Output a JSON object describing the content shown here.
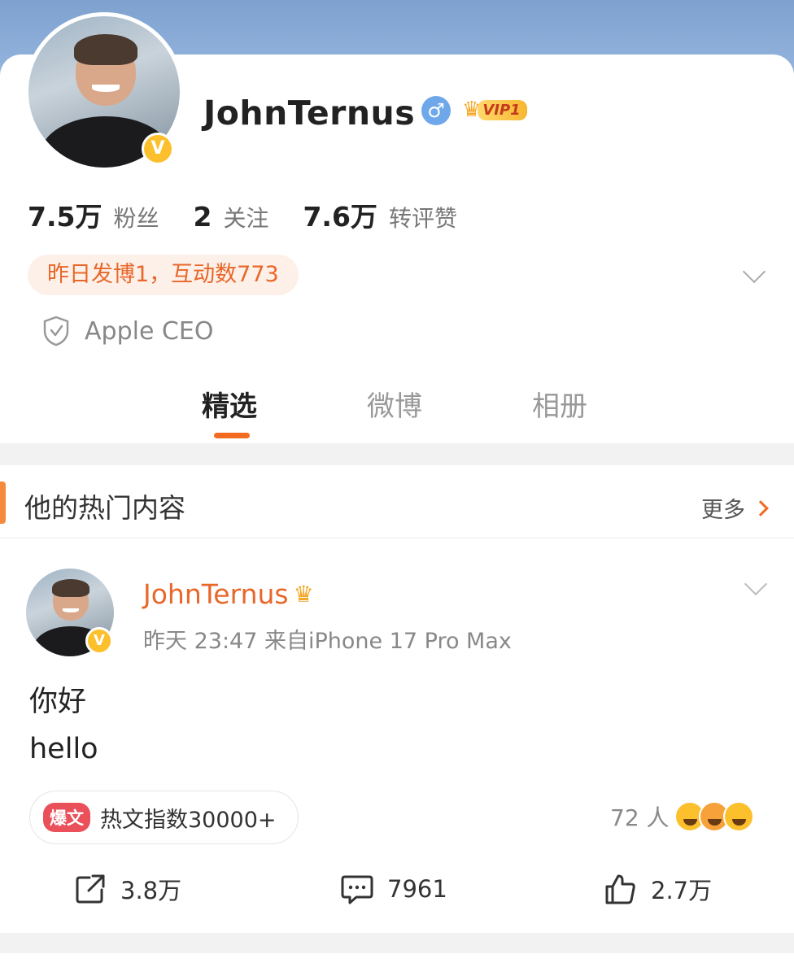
{
  "profile": {
    "username": "JohnTernus",
    "vip_label": "VIP1",
    "verified_mark": "V",
    "gender_symbol": "♂",
    "stats": [
      {
        "value": "7.5万",
        "label": "粉丝"
      },
      {
        "value": "2",
        "label": "关注"
      },
      {
        "value": "7.6万",
        "label": "转评赞"
      }
    ],
    "activity": "昨日发博1，互动数773",
    "certification": "Apple CEO"
  },
  "tabs": [
    {
      "label": "精选",
      "active": true
    },
    {
      "label": "微博",
      "active": false
    },
    {
      "label": "相册",
      "active": false
    }
  ],
  "hot_section": {
    "title": "他的热门内容",
    "more_label": "更多"
  },
  "post": {
    "author": "JohnTernus",
    "meta": "昨天 23:47  来自iPhone 17 Pro Max",
    "body_lines": [
      "你好",
      "hello"
    ],
    "hot_badge": "爆文",
    "hot_index": "热文指数30000+",
    "reactions_count": "72 人",
    "actions": {
      "repost": "3.8万",
      "comment": "7961",
      "like": "2.7万"
    }
  },
  "colors": {
    "accent": "#f26b21",
    "verified": "#fcc02d",
    "banner": "#8fb0da",
    "author_name": "#e8672a"
  },
  "icons": [
    "gender-male-icon",
    "vip-crown-icon",
    "chevron-down-icon",
    "shield-check-icon",
    "chevron-right-icon",
    "repost-icon",
    "comment-icon",
    "like-icon"
  ]
}
